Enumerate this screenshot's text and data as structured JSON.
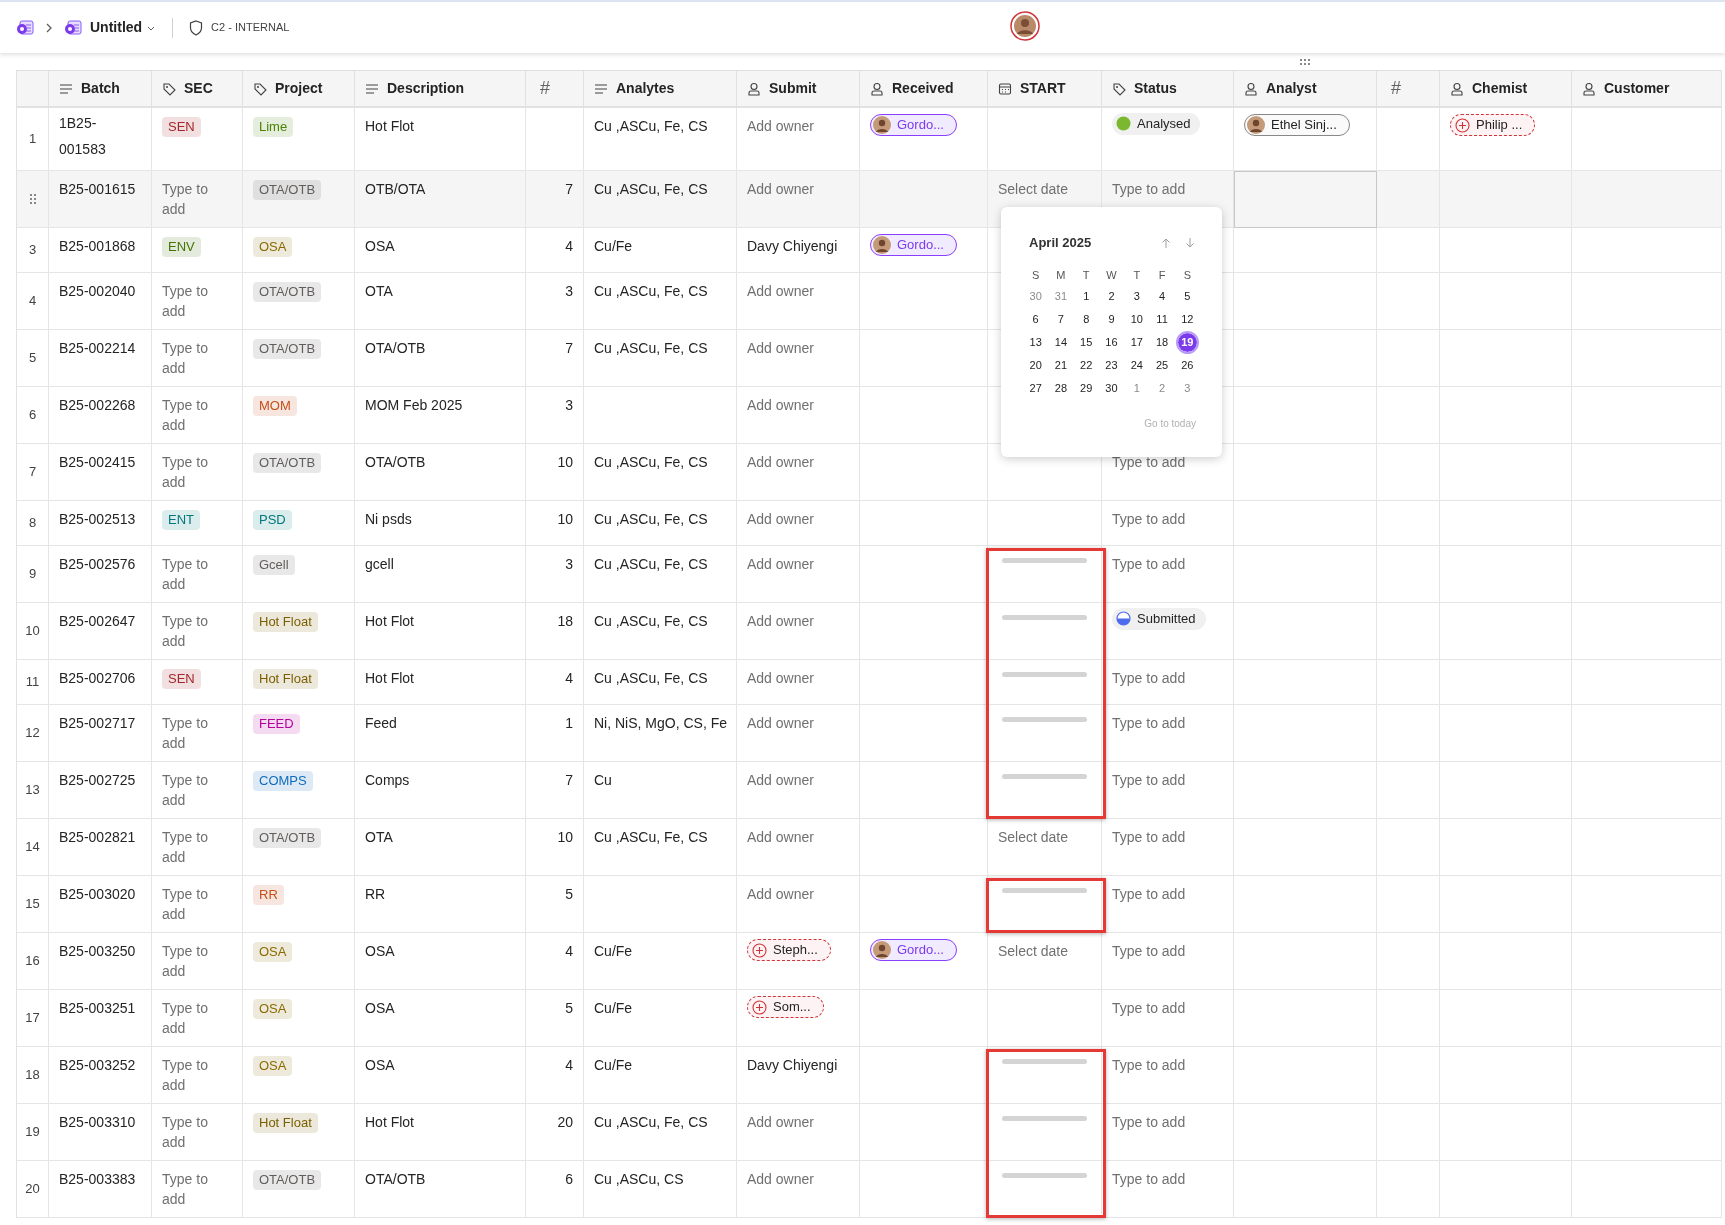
{
  "top_bar": {
    "title": "Untitled",
    "label": "C2 - INTERNAL"
  },
  "columns": [
    {
      "kind": "text",
      "label": "Batch"
    },
    {
      "kind": "tag",
      "label": "SEC"
    },
    {
      "kind": "tag",
      "label": "Project"
    },
    {
      "kind": "text",
      "label": "Description"
    },
    {
      "kind": "number",
      "label": "#"
    },
    {
      "kind": "text",
      "label": "Analytes"
    },
    {
      "kind": "person",
      "label": "Submit"
    },
    {
      "kind": "person",
      "label": "Received"
    },
    {
      "kind": "date",
      "label": "START"
    },
    {
      "kind": "tag",
      "label": "Status"
    },
    {
      "kind": "person",
      "label": "Analyst"
    },
    {
      "kind": "number",
      "label": "#"
    },
    {
      "kind": "person",
      "label": "Chemist"
    },
    {
      "kind": "person",
      "label": "Customer"
    }
  ],
  "rows": [
    {
      "number": "1",
      "selected": false,
      "batch": "1B25-001583",
      "sec": {
        "kind": "tag",
        "text": "SEN",
        "color": "#a4262c"
      },
      "project": {
        "kind": "tag",
        "text": "Lime",
        "color": "#498205"
      },
      "description": "Hot Flot",
      "analytes": "Cu ,ASCu, Fe, CS",
      "submit": {
        "kind": "placeholder",
        "text": "Add owner"
      },
      "received": {
        "kind": "person",
        "text": "Gordo..."
      },
      "status": {
        "kind": "complete",
        "text": "Analysed",
        "color": "#7cb82f"
      },
      "analyst": {
        "kind": "guest",
        "text": "Ethel Sinj..."
      },
      "chemist": {
        "kind": "unresolved",
        "text": "Philip ..."
      }
    },
    {
      "selected": true,
      "batch": "B25-001615",
      "sec": {
        "kind": "placeholder",
        "text": "Type to add"
      },
      "project": {
        "kind": "tag",
        "text": "OTA/OTB",
        "color": "#605e5c"
      },
      "description": "OTB/OTA",
      "count": "7",
      "analytes": "Cu ,ASCu, Fe, CS",
      "submit": {
        "kind": "placeholder",
        "text": "Add owner"
      },
      "start": {
        "kind": "placeholder",
        "text": "Select date"
      },
      "status": {
        "kind": "placeholder",
        "text": "Type to add"
      }
    },
    {
      "number": "3",
      "selected": false,
      "batch": "B25-001868",
      "sec": {
        "kind": "tag",
        "text": "ENV",
        "color": "#437406"
      },
      "project": {
        "kind": "tag",
        "text": "OSA",
        "color": "#8a6a00"
      },
      "description": "OSA",
      "count": "4",
      "analytes": "Cu/Fe",
      "submit": "Davy Chiyengi",
      "received": {
        "kind": "person",
        "text": "Gordo..."
      }
    },
    {
      "number": "4",
      "selected": false,
      "batch": "B25-002040",
      "sec": {
        "kind": "placeholder",
        "text": "Type to add"
      },
      "project": {
        "kind": "tag",
        "text": "OTA/OTB",
        "color": "#605e5c"
      },
      "description": "OTA",
      "count": "3",
      "analytes": "Cu ,ASCu, Fe, CS",
      "submit": {
        "kind": "placeholder",
        "text": "Add owner"
      }
    },
    {
      "number": "5",
      "selected": false,
      "batch": "B25-002214",
      "sec": {
        "kind": "placeholder",
        "text": "Type to add"
      },
      "project": {
        "kind": "tag",
        "text": "OTA/OTB",
        "color": "#605e5c"
      },
      "description": "OTA/OTB",
      "count": "7",
      "analytes": "Cu ,ASCu, Fe, CS",
      "submit": {
        "kind": "placeholder",
        "text": "Add owner"
      }
    },
    {
      "number": "6",
      "selected": false,
      "batch": "B25-002268",
      "sec": {
        "kind": "placeholder",
        "text": "Type to add"
      },
      "project": {
        "kind": "tag",
        "text": "MOM",
        "color": "#c4501a"
      },
      "description": "MOM Feb 2025",
      "count": "3",
      "submit": {
        "kind": "placeholder",
        "text": "Add owner"
      }
    },
    {
      "number": "7",
      "selected": false,
      "batch": "B25-002415",
      "sec": {
        "kind": "placeholder",
        "text": "Type to add"
      },
      "project": {
        "kind": "tag",
        "text": "OTA/OTB",
        "color": "#605e5c"
      },
      "description": "OTA/OTB",
      "count": "10",
      "analytes": "Cu ,ASCu, Fe, CS",
      "submit": {
        "kind": "placeholder",
        "text": "Add owner"
      },
      "status": {
        "kind": "placeholder",
        "text": "Type to add"
      }
    },
    {
      "number": "8",
      "selected": false,
      "batch": "B25-002513",
      "sec": {
        "kind": "tag",
        "text": "ENT",
        "color": "#03787c"
      },
      "project": {
        "kind": "tag",
        "text": "PSD",
        "color": "#03787c"
      },
      "description": "Ni psds",
      "count": "10",
      "analytes": "Cu ,ASCu, Fe, CS",
      "submit": {
        "kind": "placeholder",
        "text": "Add owner"
      },
      "status": {
        "kind": "placeholder",
        "text": "Type to add"
      }
    },
    {
      "number": "9",
      "selected": false,
      "batch": "B25-002576",
      "sec": {
        "kind": "placeholder",
        "text": "Type to add"
      },
      "project": {
        "kind": "tag",
        "text": "Gcell",
        "color": "#605e5c"
      },
      "description": "gcell",
      "count": "3",
      "analytes": "Cu ,ASCu, Fe, CS",
      "submit": {
        "kind": "placeholder",
        "text": "Add owner"
      },
      "start": {
        "kind": "loading"
      },
      "status": {
        "kind": "placeholder",
        "text": "Type to add"
      }
    },
    {
      "number": "10",
      "selected": false,
      "batch": "B25-002647",
      "sec": {
        "kind": "placeholder",
        "text": "Type to add"
      },
      "project": {
        "kind": "tag",
        "text": "Hot Float",
        "color": "#7a5f00"
      },
      "description": "Hot Flot",
      "count": "18",
      "analytes": "Cu ,ASCu, Fe, CS",
      "submit": {
        "kind": "placeholder",
        "text": "Add owner"
      },
      "start": {
        "kind": "loading"
      },
      "status": {
        "kind": "partial",
        "text": "Submitted",
        "color": "#4f6bed"
      }
    },
    {
      "number": "11",
      "selected": false,
      "batch": "B25-002706",
      "sec": {
        "kind": "tag",
        "text": "SEN",
        "color": "#a4262c"
      },
      "project": {
        "kind": "tag",
        "text": "Hot Float",
        "color": "#7a5f00"
      },
      "description": "Hot Flot",
      "count": "4",
      "analytes": "Cu ,ASCu, Fe, CS",
      "submit": {
        "kind": "placeholder",
        "text": "Add owner"
      },
      "start": {
        "kind": "loading"
      },
      "status": {
        "kind": "placeholder",
        "text": "Type to add"
      }
    },
    {
      "number": "12",
      "selected": false,
      "batch": "B25-002717",
      "sec": {
        "kind": "placeholder",
        "text": "Type to add"
      },
      "project": {
        "kind": "tag",
        "text": "FEED",
        "color": "#b4009e"
      },
      "description": "Feed",
      "count": "1",
      "analytes": "Ni, NiS, MgO, CS, Fe",
      "submit": {
        "kind": "placeholder",
        "text": "Add owner"
      },
      "start": {
        "kind": "loading"
      },
      "status": {
        "kind": "placeholder",
        "text": "Type to add"
      }
    },
    {
      "number": "13",
      "selected": false,
      "batch": "B25-002725",
      "sec": {
        "kind": "placeholder",
        "text": "Type to add"
      },
      "project": {
        "kind": "tag",
        "text": "COMPS",
        "color": "#0f6cbd"
      },
      "description": "Comps",
      "count": "7",
      "analytes": "Cu",
      "submit": {
        "kind": "placeholder",
        "text": "Add owner"
      },
      "start": {
        "kind": "loading"
      },
      "status": {
        "kind": "placeholder",
        "text": "Type to add"
      }
    },
    {
      "number": "14",
      "selected": false,
      "batch": "B25-002821",
      "sec": {
        "kind": "placeholder",
        "text": "Type to add"
      },
      "project": {
        "kind": "tag",
        "text": "OTA/OTB",
        "color": "#605e5c"
      },
      "description": "OTA",
      "count": "10",
      "analytes": "Cu ,ASCu, Fe, CS",
      "submit": {
        "kind": "placeholder",
        "text": "Add owner"
      },
      "start": {
        "kind": "placeholder",
        "text": "Select date"
      },
      "status": {
        "kind": "placeholder",
        "text": "Type to add"
      }
    },
    {
      "number": "15",
      "selected": false,
      "batch": "B25-003020",
      "sec": {
        "kind": "placeholder",
        "text": "Type to add"
      },
      "project": {
        "kind": "tag",
        "text": "RR",
        "color": "#c4501a"
      },
      "description": "RR",
      "count": "5",
      "submit": {
        "kind": "placeholder",
        "text": "Add owner"
      },
      "start": {
        "kind": "loading"
      },
      "status": {
        "kind": "placeholder",
        "text": "Type to add"
      }
    },
    {
      "number": "16",
      "selected": false,
      "batch": "B25-003250",
      "sec": {
        "kind": "placeholder",
        "text": "Type to add"
      },
      "project": {
        "kind": "tag",
        "text": "OSA",
        "color": "#8a6a00"
      },
      "description": "OSA",
      "count": "4",
      "analytes": "Cu/Fe",
      "submit": {
        "kind": "unresolved",
        "text": "Steph..."
      },
      "received": {
        "kind": "person",
        "text": "Gordo..."
      },
      "start": {
        "kind": "placeholder",
        "text": "Select date"
      },
      "status": {
        "kind": "placeholder",
        "text": "Type to add"
      }
    },
    {
      "number": "17",
      "selected": false,
      "batch": "B25-003251",
      "sec": {
        "kind": "placeholder",
        "text": "Type to add"
      },
      "project": {
        "kind": "tag",
        "text": "OSA",
        "color": "#8a6a00"
      },
      "description": "OSA",
      "count": "5",
      "analytes": "Cu/Fe",
      "submit": {
        "kind": "unresolved",
        "text": "Som..."
      },
      "status": {
        "kind": "placeholder",
        "text": "Type to add"
      }
    },
    {
      "number": "18",
      "selected": false,
      "batch": "B25-003252",
      "sec": {
        "kind": "placeholder",
        "text": "Type to add"
      },
      "project": {
        "kind": "tag",
        "text": "OSA",
        "color": "#8a6a00"
      },
      "description": "OSA",
      "count": "4",
      "analytes": "Cu/Fe",
      "submit": "Davy Chiyengi",
      "start": {
        "kind": "loading"
      },
      "status": {
        "kind": "placeholder",
        "text": "Type to add"
      }
    },
    {
      "number": "19",
      "selected": false,
      "batch": "B25-003310",
      "sec": {
        "kind": "placeholder",
        "text": "Type to add"
      },
      "project": {
        "kind": "tag",
        "text": "Hot Float",
        "color": "#7a5f00"
      },
      "description": "Hot Flot",
      "count": "20",
      "analytes": "Cu ,ASCu, Fe, CS",
      "submit": {
        "kind": "placeholder",
        "text": "Add owner"
      },
      "start": {
        "kind": "loading"
      },
      "status": {
        "kind": "placeholder",
        "text": "Type to add"
      }
    },
    {
      "number": "20",
      "selected": false,
      "batch": "B25-003383",
      "sec": {
        "kind": "placeholder",
        "text": "Type to add"
      },
      "project": {
        "kind": "tag",
        "text": "OTA/OTB",
        "color": "#605e5c"
      },
      "description": "OTA/OTB",
      "count": "6",
      "analytes": "Cu ,ASCu, CS",
      "submit": {
        "kind": "placeholder",
        "text": "Add owner"
      },
      "start": {
        "kind": "loading"
      },
      "status": {
        "kind": "placeholder",
        "text": "Type to add"
      }
    }
  ],
  "date_picker": {
    "title": "April 2025",
    "weekdays": [
      "S",
      "M",
      "T",
      "W",
      "T",
      "F",
      "S"
    ],
    "footer": "Go to today",
    "weeks": [
      [
        {
          "day": "30",
          "outside": true,
          "selected": false
        },
        {
          "day": "31",
          "outside": true,
          "selected": false
        },
        {
          "day": "1",
          "outside": false,
          "selected": false
        },
        {
          "day": "2",
          "outside": false,
          "selected": false
        },
        {
          "day": "3",
          "outside": false,
          "selected": false
        },
        {
          "day": "4",
          "outside": false,
          "selected": false
        },
        {
          "day": "5",
          "outside": false,
          "selected": false
        }
      ],
      [
        {
          "day": "6",
          "outside": false,
          "selected": false
        },
        {
          "day": "7",
          "outside": false,
          "selected": false
        },
        {
          "day": "8",
          "outside": false,
          "selected": false
        },
        {
          "day": "9",
          "outside": false,
          "selected": false
        },
        {
          "day": "10",
          "outside": false,
          "selected": false
        },
        {
          "day": "11",
          "outside": false,
          "selected": false
        },
        {
          "day": "12",
          "outside": false,
          "selected": false
        }
      ],
      [
        {
          "day": "13",
          "outside": false,
          "selected": false
        },
        {
          "day": "14",
          "outside": false,
          "selected": false
        },
        {
          "day": "15",
          "outside": false,
          "selected": false
        },
        {
          "day": "16",
          "outside": false,
          "selected": false
        },
        {
          "day": "17",
          "outside": false,
          "selected": false
        },
        {
          "day": "18",
          "outside": false,
          "selected": false
        },
        {
          "day": "19",
          "outside": false,
          "selected": true
        }
      ],
      [
        {
          "day": "20",
          "outside": false,
          "selected": false
        },
        {
          "day": "21",
          "outside": false,
          "selected": false
        },
        {
          "day": "22",
          "outside": false,
          "selected": false
        },
        {
          "day": "23",
          "outside": false,
          "selected": false
        },
        {
          "day": "24",
          "outside": false,
          "selected": false
        },
        {
          "day": "25",
          "outside": false,
          "selected": false
        },
        {
          "day": "26",
          "outside": false,
          "selected": false
        }
      ],
      [
        {
          "day": "27",
          "outside": false,
          "selected": false
        },
        {
          "day": "28",
          "outside": false,
          "selected": false
        },
        {
          "day": "29",
          "outside": false,
          "selected": false
        },
        {
          "day": "30",
          "outside": false,
          "selected": false
        },
        {
          "day": "1",
          "outside": true,
          "selected": false
        },
        {
          "day": "2",
          "outside": true,
          "selected": false
        },
        {
          "day": "3",
          "outside": true,
          "selected": false
        }
      ]
    ]
  }
}
